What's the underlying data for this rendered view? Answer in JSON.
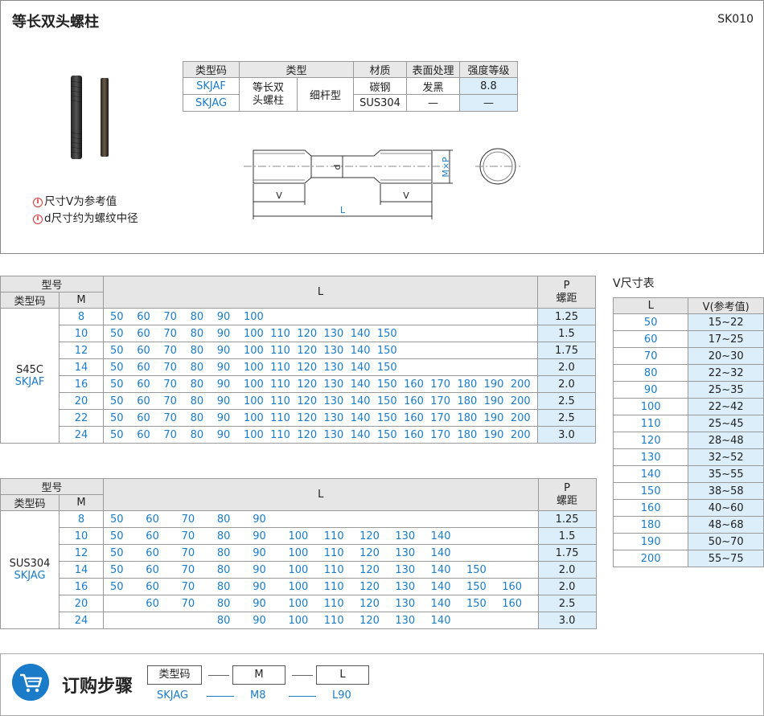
{
  "header": {
    "title": "等长双头螺柱",
    "code": "SK010",
    "notes": [
      "尺寸V为参考值",
      "d尺寸约为螺纹中径"
    ]
  },
  "spec_table": {
    "headers": [
      "类型码",
      "类型",
      "材质",
      "表面处理",
      "强度等级"
    ],
    "type_main": "等长双头螺柱",
    "type_sub": "细杆型",
    "rows": [
      {
        "code": "SKJAF",
        "material": "碳钢",
        "surface": "发黑",
        "grade": "8.8"
      },
      {
        "code": "SKJAG",
        "material": "SUS304",
        "surface": "—",
        "grade": "—"
      }
    ]
  },
  "drawing": {
    "v": "V",
    "l": "L",
    "d": "d",
    "mp": "M×P"
  },
  "s45c_table": {
    "h_model": "型号",
    "h_code": "类型码",
    "h_m": "M",
    "h_l": "L",
    "h_p": "P",
    "h_p2": "螺距",
    "material": "S45C",
    "code": "SKJAF",
    "l_columns": [
      "50",
      "60",
      "70",
      "80",
      "90",
      "100",
      "110",
      "120",
      "130",
      "140",
      "150",
      "160",
      "170",
      "180",
      "190",
      "200"
    ],
    "rows": [
      {
        "m": "8",
        "p": "1.25",
        "l": [
          "50",
          "60",
          "70",
          "80",
          "90",
          "100",
          "",
          "",
          "",
          "",
          "",
          "",
          "",
          "",
          "",
          ""
        ]
      },
      {
        "m": "10",
        "p": "1.5",
        "l": [
          "50",
          "60",
          "70",
          "80",
          "90",
          "100",
          "110",
          "120",
          "130",
          "140",
          "150",
          "",
          "",
          "",
          "",
          ""
        ]
      },
      {
        "m": "12",
        "p": "1.75",
        "l": [
          "50",
          "60",
          "70",
          "80",
          "90",
          "100",
          "110",
          "120",
          "130",
          "140",
          "150",
          "",
          "",
          "",
          "",
          ""
        ]
      },
      {
        "m": "14",
        "p": "2.0",
        "l": [
          "50",
          "60",
          "70",
          "80",
          "90",
          "100",
          "110",
          "120",
          "130",
          "140",
          "150",
          "",
          "",
          "",
          "",
          ""
        ]
      },
      {
        "m": "16",
        "p": "2.0",
        "l": [
          "50",
          "60",
          "70",
          "80",
          "90",
          "100",
          "110",
          "120",
          "130",
          "140",
          "150",
          "160",
          "170",
          "180",
          "190",
          "200"
        ]
      },
      {
        "m": "20",
        "p": "2.5",
        "l": [
          "50",
          "60",
          "70",
          "80",
          "90",
          "100",
          "110",
          "120",
          "130",
          "140",
          "150",
          "160",
          "170",
          "180",
          "190",
          "200"
        ]
      },
      {
        "m": "22",
        "p": "2.5",
        "l": [
          "50",
          "60",
          "70",
          "80",
          "90",
          "100",
          "110",
          "120",
          "130",
          "140",
          "150",
          "160",
          "170",
          "180",
          "190",
          "200"
        ]
      },
      {
        "m": "24",
        "p": "3.0",
        "l": [
          "50",
          "60",
          "70",
          "80",
          "90",
          "100",
          "110",
          "120",
          "130",
          "140",
          "150",
          "160",
          "170",
          "180",
          "190",
          "200"
        ]
      }
    ]
  },
  "sus_table": {
    "h_model": "型号",
    "h_code": "类型码",
    "h_m": "M",
    "h_l": "L",
    "h_p": "P",
    "h_p2": "螺距",
    "material": "SUS304",
    "code": "SKJAG",
    "rows": [
      {
        "m": "8",
        "p": "1.25",
        "l": [
          "50",
          "60",
          "70",
          "80",
          "90",
          "",
          "",
          "",
          "",
          "",
          "",
          ""
        ]
      },
      {
        "m": "10",
        "p": "1.5",
        "l": [
          "50",
          "60",
          "70",
          "80",
          "90",
          "100",
          "110",
          "120",
          "130",
          "140",
          "",
          ""
        ]
      },
      {
        "m": "12",
        "p": "1.75",
        "l": [
          "50",
          "60",
          "70",
          "80",
          "90",
          "100",
          "110",
          "120",
          "130",
          "140",
          "",
          ""
        ]
      },
      {
        "m": "14",
        "p": "2.0",
        "l": [
          "50",
          "60",
          "70",
          "80",
          "90",
          "100",
          "110",
          "120",
          "130",
          "140",
          "150",
          ""
        ]
      },
      {
        "m": "16",
        "p": "2.0",
        "l": [
          "50",
          "60",
          "70",
          "80",
          "90",
          "100",
          "110",
          "120",
          "130",
          "140",
          "150",
          "160"
        ]
      },
      {
        "m": "20",
        "p": "2.5",
        "l": [
          "",
          "60",
          "70",
          "80",
          "90",
          "100",
          "110",
          "120",
          "130",
          "140",
          "150",
          "160"
        ]
      },
      {
        "m": "24",
        "p": "3.0",
        "l": [
          "",
          "",
          "",
          "80",
          "90",
          "100",
          "110",
          "120",
          "130",
          "140",
          "",
          ""
        ]
      }
    ]
  },
  "v_table": {
    "title": "V尺寸表",
    "h_l": "L",
    "h_v": "V(参考值)",
    "rows": [
      {
        "l": "50",
        "v": "15~22"
      },
      {
        "l": "60",
        "v": "17~25"
      },
      {
        "l": "70",
        "v": "20~30"
      },
      {
        "l": "80",
        "v": "22~32"
      },
      {
        "l": "90",
        "v": "25~35"
      },
      {
        "l": "100",
        "v": "22~42"
      },
      {
        "l": "110",
        "v": "25~45"
      },
      {
        "l": "120",
        "v": "28~48"
      },
      {
        "l": "130",
        "v": "32~52"
      },
      {
        "l": "140",
        "v": "35~55"
      },
      {
        "l": "150",
        "v": "38~58"
      },
      {
        "l": "160",
        "v": "40~60"
      },
      {
        "l": "180",
        "v": "48~68"
      },
      {
        "l": "190",
        "v": "50~70"
      },
      {
        "l": "200",
        "v": "55~75"
      }
    ]
  },
  "order": {
    "title": "订购步骤",
    "boxes": [
      "类型码",
      "M",
      "L"
    ],
    "values": [
      "SKJAG",
      "M8",
      "L90"
    ],
    "accent": "#1a7bc9"
  }
}
